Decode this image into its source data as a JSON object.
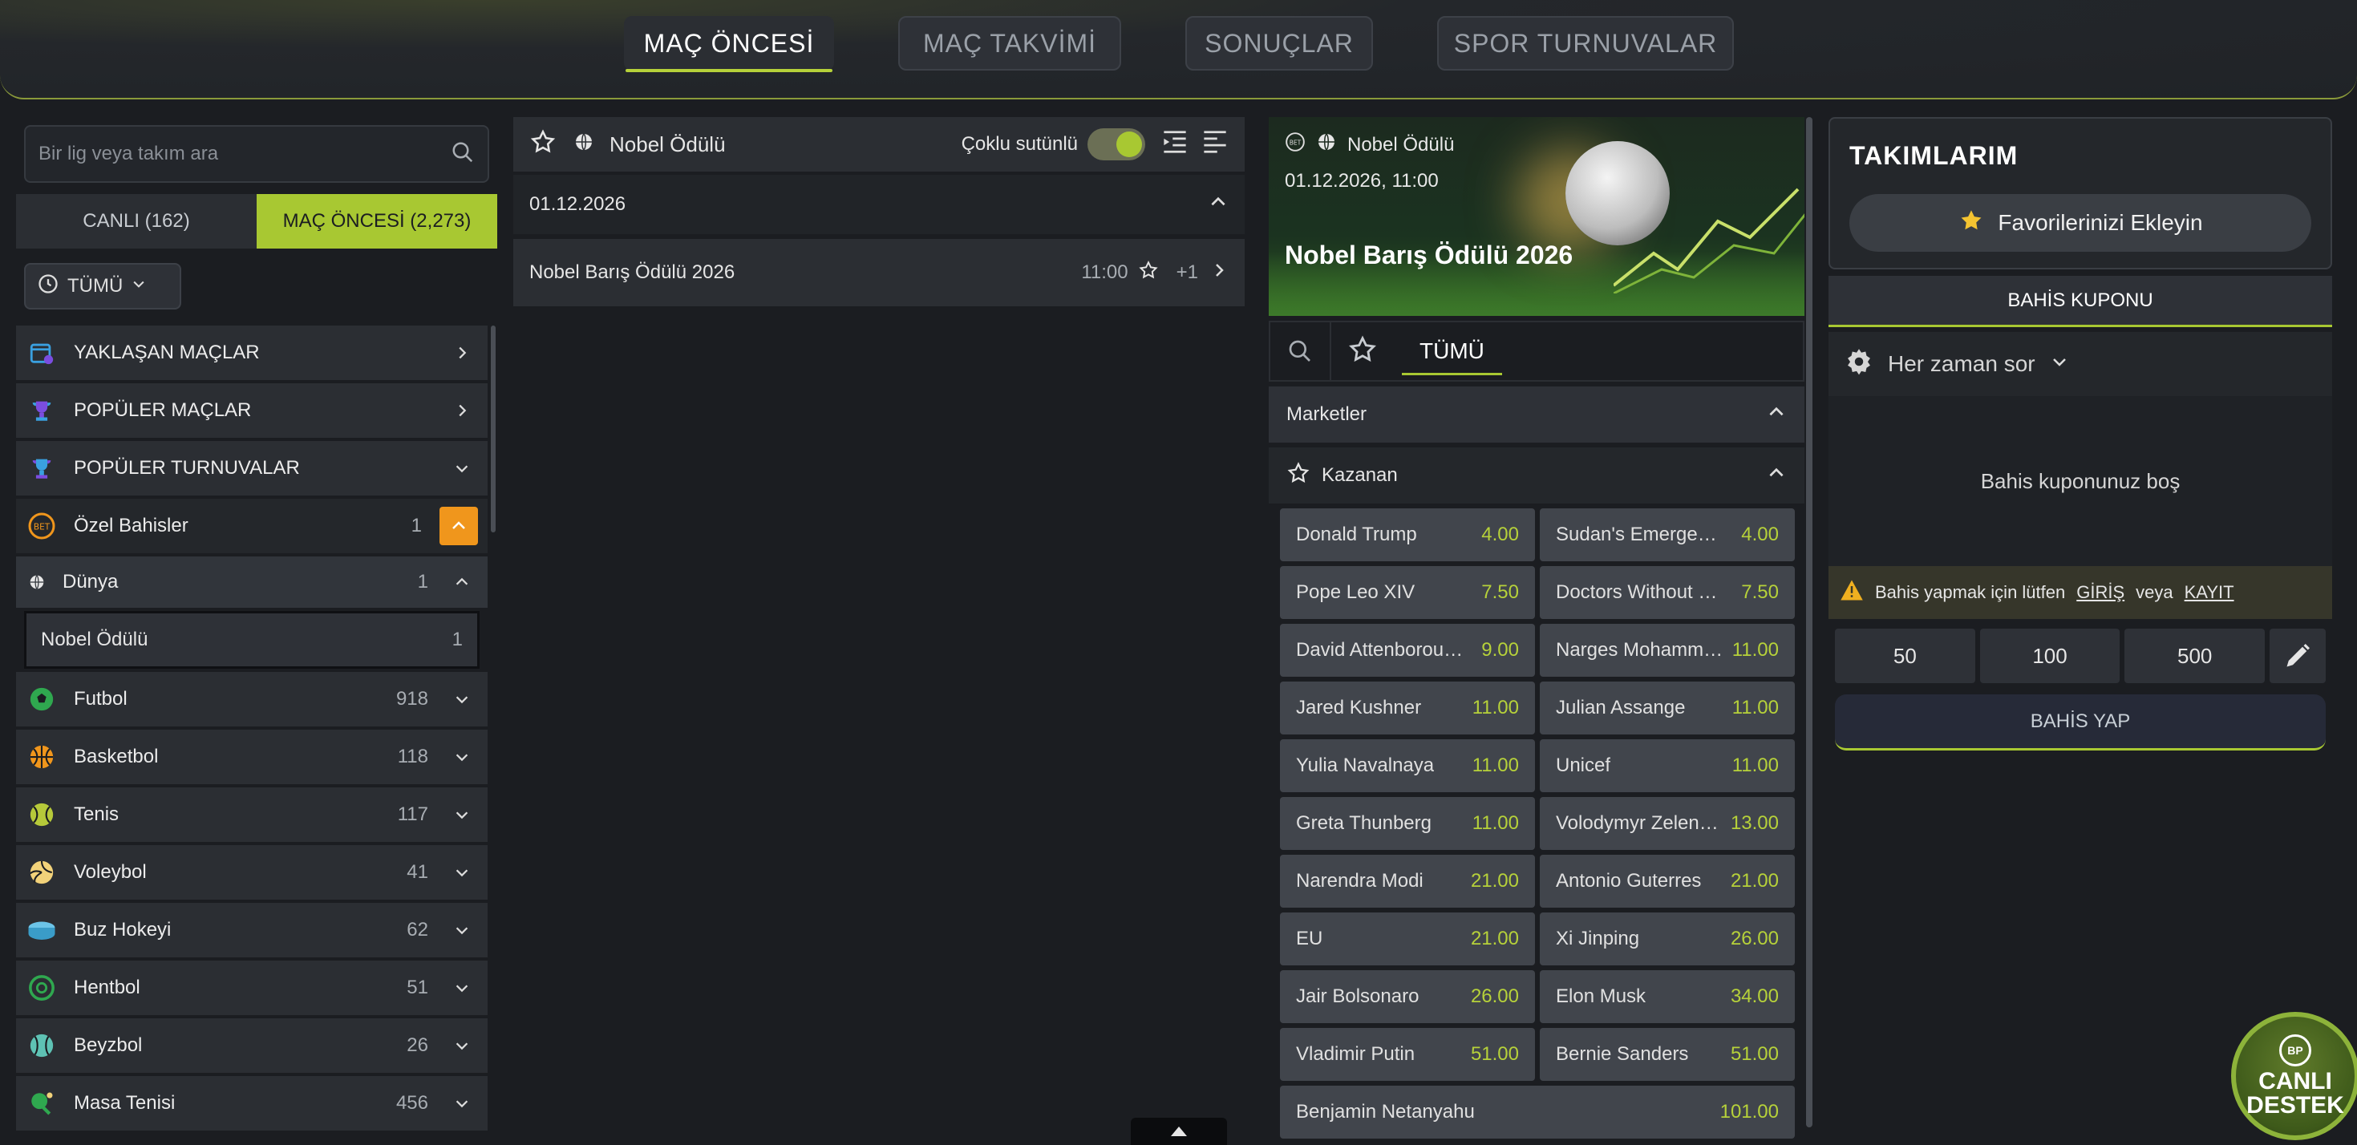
{
  "topnav": {
    "tabs": [
      {
        "label": "MAÇ ÖNCESİ",
        "active": true
      },
      {
        "label": "MAÇ TAKVİMİ",
        "active": false
      },
      {
        "label": "SONUÇLAR",
        "active": false
      },
      {
        "label": "SPOR TURNUVALAR",
        "active": false
      }
    ]
  },
  "left": {
    "search_placeholder": "Bir lig veya takım ara",
    "tabs": [
      {
        "label": "CANLI (162)"
      },
      {
        "label": "MAÇ ÖNCESİ (2,273)"
      }
    ],
    "filter": "TÜMÜ",
    "menu": [
      {
        "label": "YAKLAŞAN MAÇLAR"
      },
      {
        "label": "POPÜLER MAÇLAR"
      },
      {
        "label": "POPÜLER TURNUVALAR"
      }
    ],
    "special": {
      "label": "Özel Bahisler",
      "count": "1"
    },
    "region": {
      "label": "Dünya",
      "count": "1"
    },
    "subitem": {
      "label": "Nobel Ödülü",
      "count": "1"
    },
    "sports": [
      {
        "label": "Futbol",
        "count": "918"
      },
      {
        "label": "Basketbol",
        "count": "118"
      },
      {
        "label": "Tenis",
        "count": "117"
      },
      {
        "label": "Voleybol",
        "count": "41"
      },
      {
        "label": "Buz Hokeyi",
        "count": "62"
      },
      {
        "label": "Hentbol",
        "count": "51"
      },
      {
        "label": "Beyzbol",
        "count": "26"
      },
      {
        "label": "Masa Tenisi",
        "count": "456"
      }
    ]
  },
  "middle": {
    "title": "Nobel Ödülü",
    "multi_column_label": "Çoklu sutünlü",
    "date": "01.12.2026",
    "event": {
      "name": "Nobel Barış Ödülü 2026",
      "time": "11:00",
      "more": "+1"
    }
  },
  "detail": {
    "league": "Nobel Ödülü",
    "datetime": "01.12.2026, 11:00",
    "title": "Nobel Barış Ödülü 2026",
    "tab": "TÜMÜ",
    "markets_label": "Marketler",
    "market_name": "Kazanan",
    "odds": [
      {
        "name": "Donald Trump",
        "value": "4.00"
      },
      {
        "name": "Sudan's Emergency Response Rooms",
        "value": "4.00"
      },
      {
        "name": "Pope Leo XIV",
        "value": "7.50"
      },
      {
        "name": "Doctors Without Borders",
        "value": "7.50"
      },
      {
        "name": "David Attenborough",
        "value": "9.00"
      },
      {
        "name": "Narges Mohammadi",
        "value": "11.00"
      },
      {
        "name": "Jared Kushner",
        "value": "11.00"
      },
      {
        "name": "Julian Assange",
        "value": "11.00"
      },
      {
        "name": "Yulia Navalnaya",
        "value": "11.00"
      },
      {
        "name": "Unicef",
        "value": "11.00"
      },
      {
        "name": "Greta Thunberg",
        "value": "11.00"
      },
      {
        "name": "Volodymyr Zelensky",
        "value": "13.00"
      },
      {
        "name": "Narendra Modi",
        "value": "21.00"
      },
      {
        "name": "Antonio Guterres",
        "value": "21.00"
      },
      {
        "name": "EU",
        "value": "21.00"
      },
      {
        "name": "Xi Jinping",
        "value": "26.00"
      },
      {
        "name": "Jair Bolsonaro",
        "value": "26.00"
      },
      {
        "name": "Elon Musk",
        "value": "34.00"
      },
      {
        "name": "Vladimir Putin",
        "value": "51.00"
      },
      {
        "name": "Bernie Sanders",
        "value": "51.00"
      },
      {
        "name": "Benjamin Netanyahu",
        "value": "101.00"
      }
    ]
  },
  "right": {
    "teams_title": "TAKIMLARIM",
    "fav_button": "Favorilerinizi Ekleyin",
    "coupon_title": "BAHİS KUPONU",
    "ask_label": "Her zaman sor",
    "empty_text": "Bahis kuponunuz boş",
    "warn_text": "Bahis yapmak için lütfen",
    "login": "GİRİŞ",
    "or": "veya",
    "register": "KAYIT",
    "stakes": [
      "50",
      "100",
      "500"
    ],
    "place_bet": "BAHİS YAP"
  },
  "support": {
    "badge": "BP",
    "line1": "CANLI",
    "line2": "DESTEK"
  },
  "colors": {
    "accent": "#a8c832",
    "orange": "#f0961c",
    "odds": "#b6d13a"
  }
}
